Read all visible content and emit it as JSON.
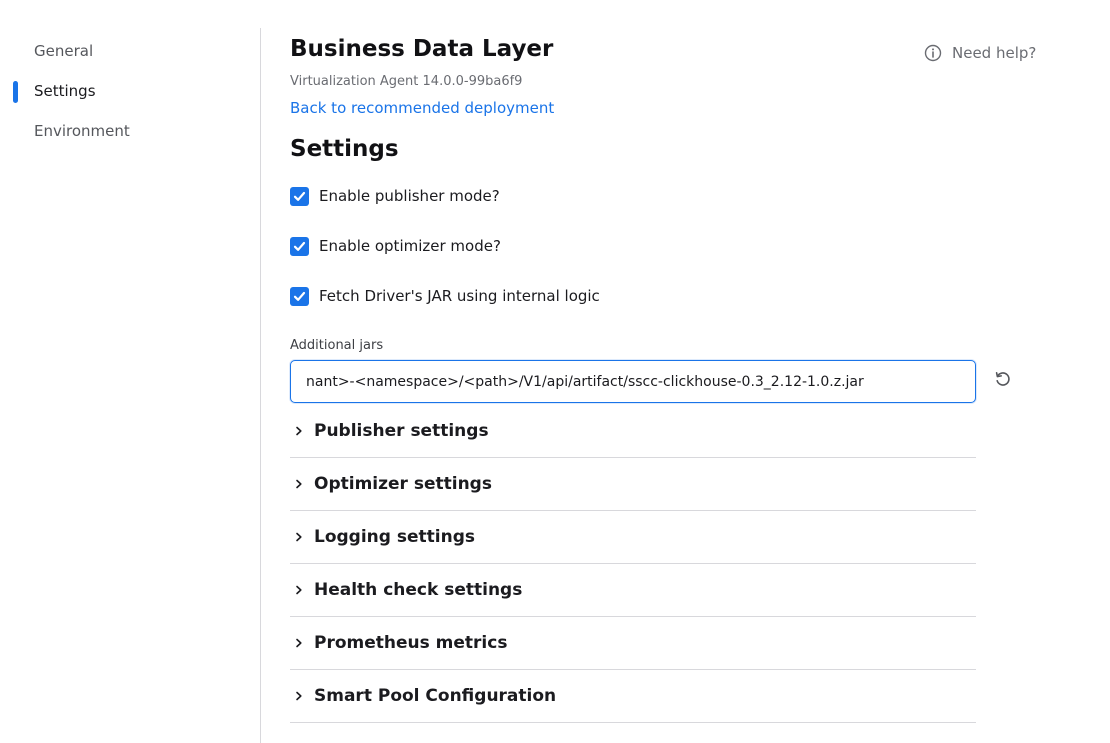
{
  "sidebar": {
    "items": [
      {
        "label": "General",
        "active": false
      },
      {
        "label": "Settings",
        "active": true
      },
      {
        "label": "Environment",
        "active": false
      }
    ]
  },
  "header": {
    "title": "Business Data Layer",
    "subtitle": "Virtualization Agent 14.0.0-99ba6f9",
    "back_link": "Back to recommended deployment",
    "help_label": "Need help?"
  },
  "settings": {
    "heading": "Settings",
    "checkboxes": [
      {
        "label": "Enable publisher mode?",
        "checked": true
      },
      {
        "label": "Enable optimizer mode?",
        "checked": true
      },
      {
        "label": "Fetch Driver's JAR using internal logic",
        "checked": true
      }
    ],
    "additional_jars": {
      "label": "Additional jars",
      "value": "nant>-<namespace>/<path>/V1/api/artifact/sscc-clickhouse-0.3_2.12-1.0.z.jar"
    },
    "sections": [
      {
        "label": "Publisher settings"
      },
      {
        "label": "Optimizer settings"
      },
      {
        "label": "Logging settings"
      },
      {
        "label": "Health check settings"
      },
      {
        "label": "Prometheus metrics"
      },
      {
        "label": "Smart Pool Configuration"
      }
    ]
  },
  "colors": {
    "accent": "#1a74e8",
    "divider": "#d8d8dc"
  },
  "icons": {
    "help": "info-circle-icon",
    "reset": "reset-icon",
    "check": "checkmark-icon",
    "chevron": "chevron-right-icon"
  }
}
